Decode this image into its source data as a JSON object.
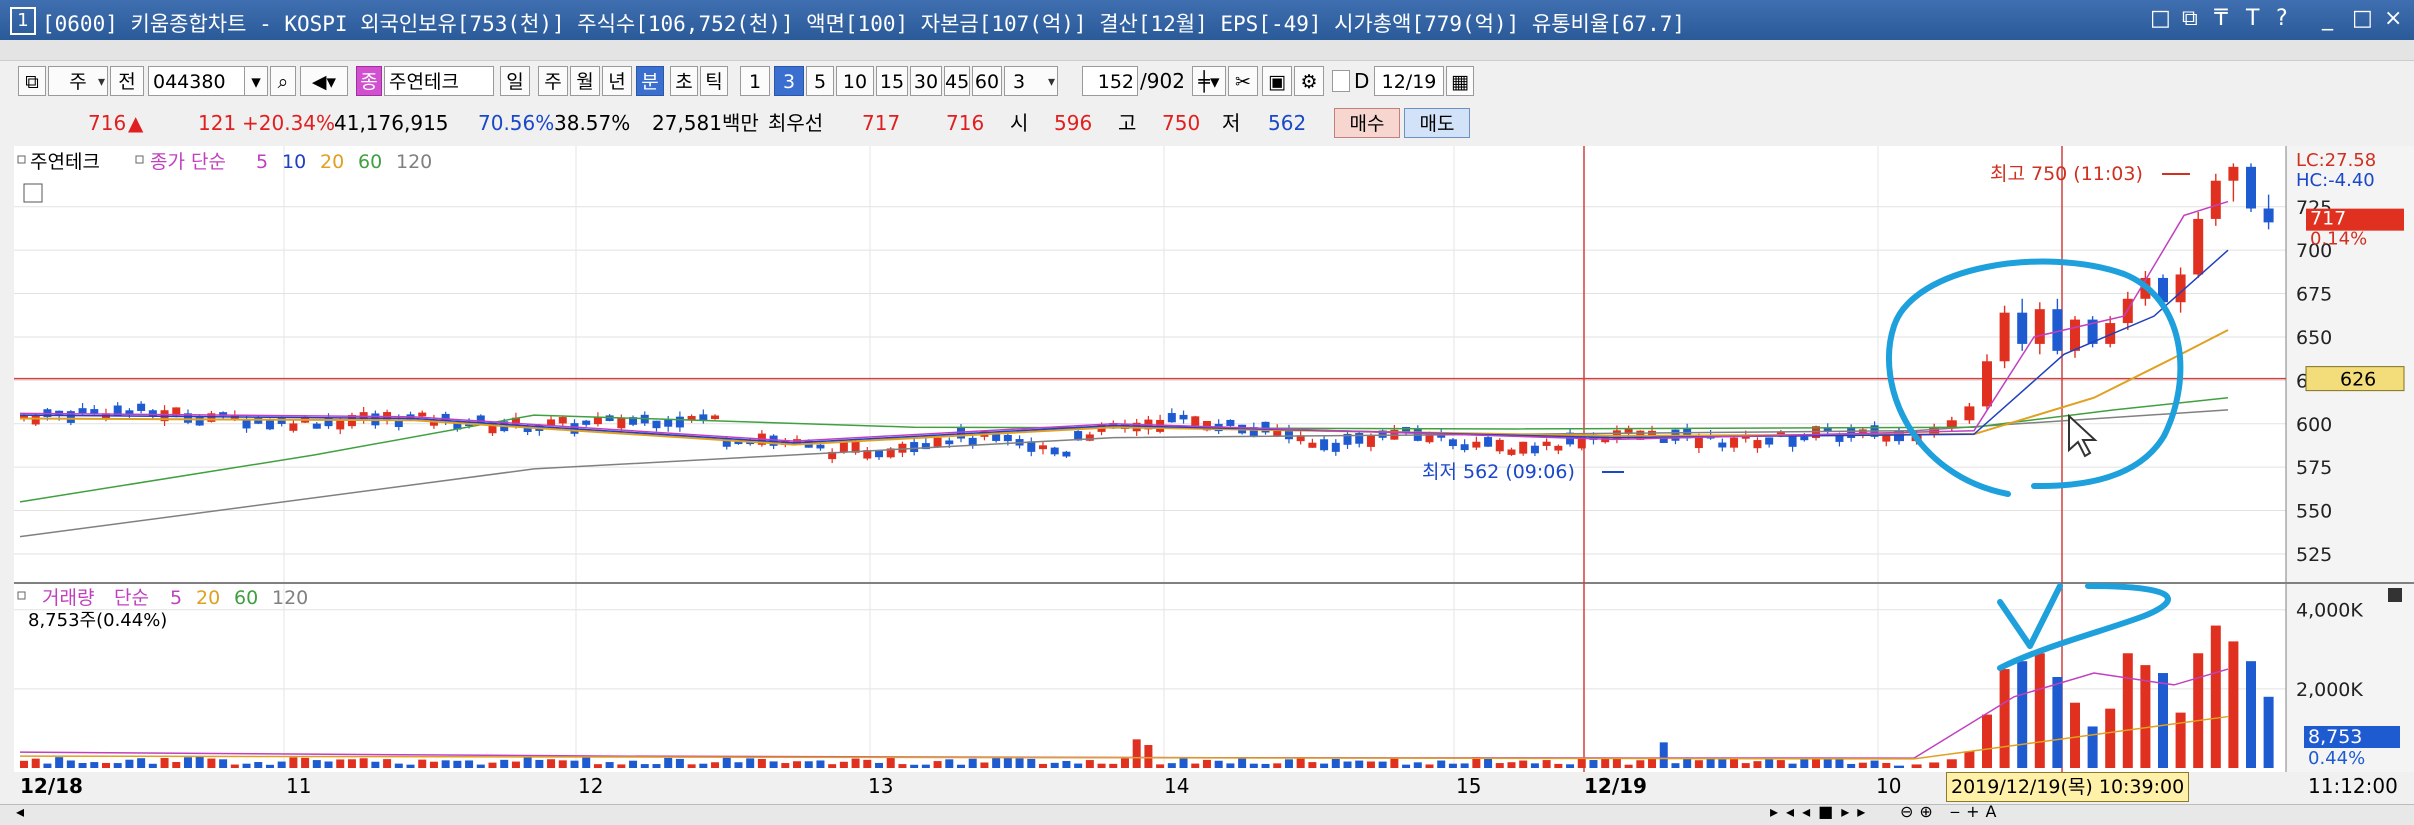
{
  "window": {
    "number": "1",
    "title": "[0600] 키움종합차트 - KOSPI 외국인보유[753(천)] 주식수[106,752(천)] 액면[100] 자본금[107(억)] 결산[12월] EPS[-49] 시가총액[779(억)] 유통비율[67.7]",
    "buttons": [
      "□",
      "⧉",
      "₸",
      "T",
      "?",
      "_",
      "□",
      "×"
    ]
  },
  "toolbar": {
    "type_label": "주",
    "prev_label": "전",
    "code": "044380",
    "stock_tag": "종",
    "stock_name": "주연테크",
    "periods": [
      "일",
      "주",
      "월",
      "년",
      "분",
      "초",
      "틱"
    ],
    "active_period": "분",
    "intervals": [
      "1",
      "3",
      "5",
      "10",
      "15",
      "30",
      "45",
      "60"
    ],
    "active_interval": "3",
    "interval_select": "3",
    "count": "152",
    "total": "/902",
    "d_label": "D",
    "date": "12/19"
  },
  "quote": {
    "price": "716",
    "arrow": "▲",
    "change": "121",
    "change_pct": "+20.34%",
    "volume": "41,176,915",
    "ratio1": "70.56%",
    "ratio2": "38.57%",
    "amount": "27,581백만",
    "best_label": "최우선",
    "ask": "717",
    "bid": "716",
    "open_label": "시",
    "open": "596",
    "high_label": "고",
    "high": "750",
    "low_label": "저",
    "low": "562",
    "buy_label": "매수",
    "sell_label": "매도"
  },
  "price_panel": {
    "stock_legend": "주연테크",
    "ma_legend": "종가 단순",
    "ma_periods": [
      "5",
      "10",
      "20",
      "60",
      "120"
    ],
    "ma_colors": [
      "#c040c0",
      "#2040c0",
      "#e0a020",
      "#40a040",
      "#808080"
    ],
    "high_annotation": "최고 750 (11:03)",
    "low_annotation": "최저 562 (09:06)",
    "lc": "LC:27.58",
    "hc": "HC:-4.40",
    "current_tag": "717",
    "current_pct": "0.14%",
    "crosshair_tag": "626",
    "y_ticks": [
      "725",
      "700",
      "675",
      "650",
      "625",
      "600",
      "575",
      "550",
      "525"
    ]
  },
  "volume_panel": {
    "legend": "거래량",
    "ma_legend": "단순",
    "ma_periods": [
      "5",
      "20",
      "60",
      "120"
    ],
    "ma_colors": [
      "#c040c0",
      "#e0a020",
      "#40a040",
      "#808080"
    ],
    "sub_value": "8,753주(0.44%)",
    "y_ticks": [
      "4,000K",
      "2,000K"
    ],
    "current_tag": "8,753",
    "current_pct": "0.44%"
  },
  "x_axis": {
    "labels": [
      {
        "text": "12/18",
        "bold": true
      },
      {
        "text": "11",
        "bold": false
      },
      {
        "text": "12",
        "bold": false
      },
      {
        "text": "13",
        "bold": false
      },
      {
        "text": "14",
        "bold": false
      },
      {
        "text": "15",
        "bold": false
      },
      {
        "text": "12/19",
        "bold": true
      },
      {
        "text": "10",
        "bold": false
      }
    ],
    "crosshair_label": "2019/12/19(목) 10:39:00",
    "time_label": "11:12:00"
  },
  "chart_data": {
    "type": "candlestick",
    "title": "",
    "y_range": [
      510,
      760
    ],
    "volume_range": [
      0,
      4600
    ],
    "volume_unit": "K",
    "candles_late": [
      {
        "o": 596,
        "h": 598,
        "l": 588,
        "c": 590,
        "v": 60
      },
      {
        "o": 590,
        "h": 596,
        "l": 588,
        "c": 594,
        "v": 90
      },
      {
        "o": 594,
        "h": 600,
        "l": 592,
        "c": 598,
        "v": 140
      },
      {
        "o": 598,
        "h": 604,
        "l": 596,
        "c": 602,
        "v": 220
      },
      {
        "o": 602,
        "h": 612,
        "l": 600,
        "c": 610,
        "v": 420
      },
      {
        "o": 610,
        "h": 640,
        "l": 608,
        "c": 636,
        "v": 1350
      },
      {
        "o": 636,
        "h": 668,
        "l": 632,
        "c": 664,
        "v": 2500
      },
      {
        "o": 664,
        "h": 672,
        "l": 642,
        "c": 646,
        "v": 2700
      },
      {
        "o": 646,
        "h": 670,
        "l": 640,
        "c": 666,
        "v": 2900
      },
      {
        "o": 666,
        "h": 672,
        "l": 640,
        "c": 642,
        "v": 2300
      },
      {
        "o": 642,
        "h": 662,
        "l": 638,
        "c": 660,
        "v": 1650
      },
      {
        "o": 660,
        "h": 662,
        "l": 644,
        "c": 646,
        "v": 1050
      },
      {
        "o": 646,
        "h": 662,
        "l": 644,
        "c": 658,
        "v": 1500
      },
      {
        "o": 658,
        "h": 676,
        "l": 654,
        "c": 672,
        "v": 2900
      },
      {
        "o": 672,
        "h": 688,
        "l": 668,
        "c": 684,
        "v": 2600
      },
      {
        "o": 684,
        "h": 686,
        "l": 666,
        "c": 670,
        "v": 2400
      },
      {
        "o": 670,
        "h": 690,
        "l": 664,
        "c": 686,
        "v": 1400
      },
      {
        "o": 686,
        "h": 722,
        "l": 684,
        "c": 718,
        "v": 2900
      },
      {
        "o": 718,
        "h": 744,
        "l": 714,
        "c": 740,
        "v": 3600
      },
      {
        "o": 740,
        "h": 750,
        "l": 728,
        "c": 748,
        "v": 3200
      },
      {
        "o": 748,
        "h": 750,
        "l": 722,
        "c": 724,
        "v": 2700
      },
      {
        "o": 724,
        "h": 732,
        "l": 712,
        "c": 716,
        "v": 1800
      }
    ]
  }
}
